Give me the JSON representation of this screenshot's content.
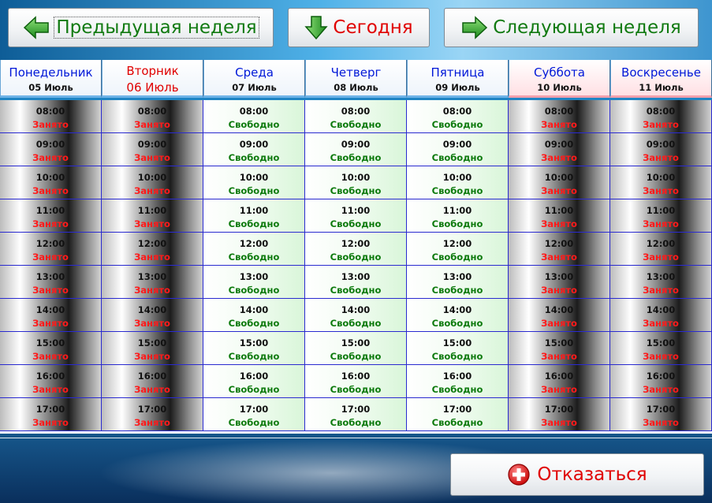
{
  "nav": {
    "prev_week_label": "Предыдущая неделя",
    "today_label": "Сегодня",
    "next_week_label": "Следующая неделя",
    "cancel_label": "Отказаться"
  },
  "days": [
    {
      "name": "Понедельник",
      "date": "05 Июль"
    },
    {
      "name": "Вторник",
      "date": "06 Июль"
    },
    {
      "name": "Среда",
      "date": "07 Июль"
    },
    {
      "name": "Четверг",
      "date": "08 Июль"
    },
    {
      "name": "Пятница",
      "date": "09 Июль"
    },
    {
      "name": "Суббота",
      "date": "10 Июль"
    },
    {
      "name": "Воскресенье",
      "date": "11 Июль"
    }
  ],
  "times": [
    "08:00",
    "09:00",
    "10:00",
    "11:00",
    "12:00",
    "13:00",
    "14:00",
    "15:00",
    "16:00",
    "17:00"
  ],
  "status_labels": {
    "busy": "Занято",
    "free": "Свободно"
  },
  "availability": [
    "busy",
    "busy",
    "free",
    "free",
    "free",
    "busy",
    "busy"
  ],
  "colors": {
    "busy_text": "#ff1a1a",
    "free_text": "#0d7a0d",
    "today_text": "#e00000",
    "day_name_text": "#0018d8",
    "nav_text": "#117a11"
  }
}
